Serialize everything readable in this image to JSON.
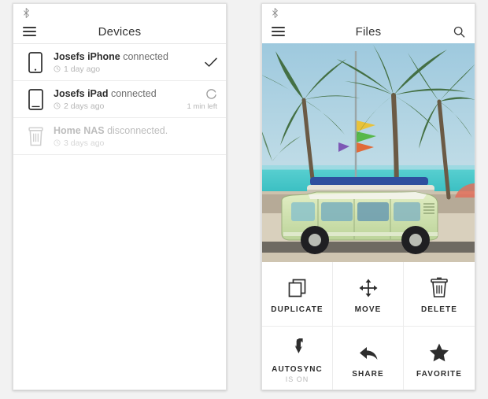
{
  "devices_panel": {
    "statusbar": {
      "bluetooth_icon": "bluetooth-icon"
    },
    "appbar": {
      "menu_icon": "hamburger-menu-icon",
      "title": "Devices"
    },
    "items": [
      {
        "icon": "iphone-icon",
        "name": "Josefs iPhone",
        "state": " connected",
        "timestamp": "1 day ago",
        "clock_icon": "clock-icon",
        "status_icon": "check-icon",
        "eta": "",
        "disabled": false
      },
      {
        "icon": "ipad-icon",
        "name": "Josefs iPad",
        "state": " connected",
        "timestamp": "2 days ago",
        "clock_icon": "clock-icon",
        "status_icon": "sync-spinner-icon",
        "eta": "1 min left",
        "disabled": false
      },
      {
        "icon": "nas-server-icon",
        "name": "Home NAS",
        "state": " disconnected.",
        "timestamp": "3 days ago",
        "clock_icon": "clock-icon",
        "status_icon": "",
        "eta": "",
        "disabled": true
      }
    ]
  },
  "files_panel": {
    "statusbar": {
      "bluetooth_icon": "bluetooth-icon"
    },
    "appbar": {
      "menu_icon": "hamburger-menu-icon",
      "title": "Files",
      "search_icon": "search-icon"
    },
    "photo": {
      "name": "beach-van-photo",
      "description": "VW camper van with surfboards parked by a palm-lined beach",
      "colors": {
        "sky": "#a8cfe0",
        "ocean": "#3fc6c8",
        "van_body": "#cfe0ab",
        "sand": "#ded6c4",
        "palm_green": "#4a6b3a"
      }
    },
    "actions": [
      {
        "icon": "duplicate-icon",
        "label": "DUPLICATE",
        "sub": ""
      },
      {
        "icon": "move-icon",
        "label": "MOVE",
        "sub": ""
      },
      {
        "icon": "delete-trash-icon",
        "label": "DELETE",
        "sub": ""
      },
      {
        "icon": "autosync-bolt-icon",
        "label": "AUTOSYNC",
        "sub": "IS ON"
      },
      {
        "icon": "share-arrow-icon",
        "label": "SHARE",
        "sub": ""
      },
      {
        "icon": "favorite-star-icon",
        "label": "FAVORITE",
        "sub": ""
      }
    ]
  },
  "colors": {
    "page_background": "#f2f2f2",
    "panel_background": "#ffffff",
    "text_primary": "#2d2d2d",
    "text_secondary": "#6d6d6d",
    "text_muted": "#b6b6b6",
    "divider": "#ececec"
  }
}
